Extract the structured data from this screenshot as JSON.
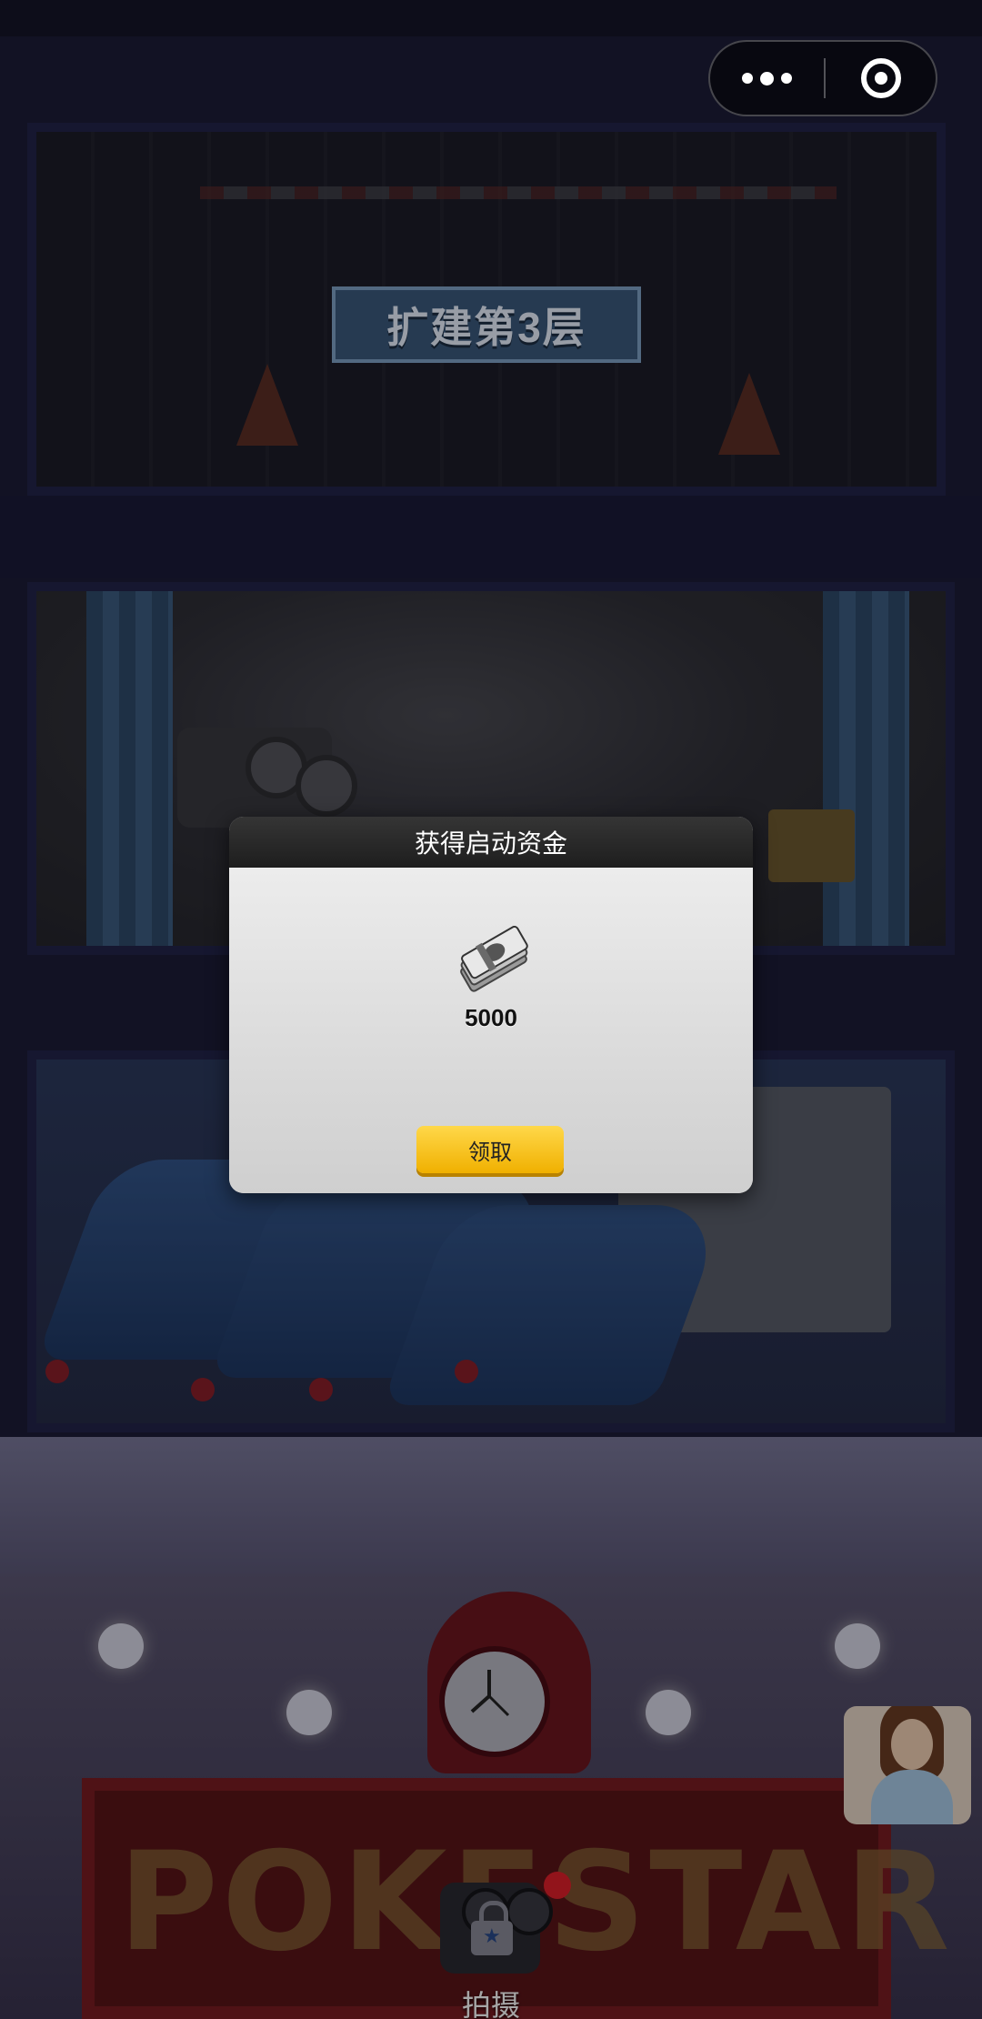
{
  "capsule": {
    "more_icon": "more-dots-icon",
    "close_icon": "target-circle-icon"
  },
  "building": {
    "expand_sign": "扩建第3层"
  },
  "modal": {
    "title": "获得启动资金",
    "reward_icon": "cash-stack-icon",
    "reward_amount": "5000",
    "claim_label": "领取"
  },
  "marquee": {
    "text": "POKESTAR"
  },
  "bottom": {
    "shoot_label": "拍摄",
    "shoot_locked": true
  },
  "colors": {
    "claim_button": "#f5c20a",
    "modal_header": "#262626",
    "sign_bg": "#3b5a7d"
  }
}
